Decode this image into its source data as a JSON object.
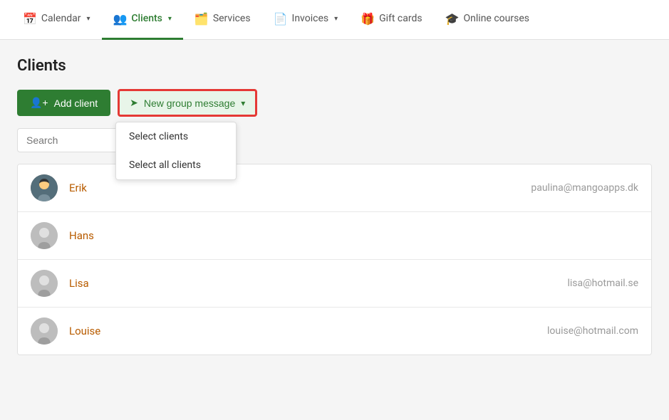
{
  "nav": {
    "items": [
      {
        "id": "calendar",
        "label": "Calendar",
        "icon": "📅",
        "active": false,
        "hasDropdown": true
      },
      {
        "id": "clients",
        "label": "Clients",
        "icon": "👥",
        "active": true,
        "hasDropdown": true
      },
      {
        "id": "services",
        "label": "Services",
        "icon": "🗂️",
        "active": false,
        "hasDropdown": false
      },
      {
        "id": "invoices",
        "label": "Invoices",
        "icon": "📄",
        "active": false,
        "hasDropdown": true
      },
      {
        "id": "gift-cards",
        "label": "Gift cards",
        "icon": "🎁",
        "active": false,
        "hasDropdown": false
      },
      {
        "id": "online-courses",
        "label": "Online courses",
        "icon": "🎓",
        "active": false,
        "hasDropdown": false
      }
    ]
  },
  "page": {
    "title": "Clients"
  },
  "toolbar": {
    "add_client_label": "Add client",
    "new_group_message_label": "New group message"
  },
  "dropdown": {
    "items": [
      {
        "id": "select-clients",
        "label": "Select clients"
      },
      {
        "id": "select-all-clients",
        "label": "Select all clients"
      }
    ]
  },
  "search": {
    "placeholder": "Search"
  },
  "clients": [
    {
      "id": "erik",
      "name": "Erik",
      "email": "paulina@mangoapps.dk",
      "hasAvatar": true
    },
    {
      "id": "hans",
      "name": "Hans",
      "email": "",
      "hasAvatar": false
    },
    {
      "id": "lisa",
      "name": "Lisa",
      "email": "lisa@hotmail.se",
      "hasAvatar": false
    },
    {
      "id": "louise",
      "name": "Louise",
      "email": "louise@hotmail.com",
      "hasAvatar": false
    }
  ]
}
